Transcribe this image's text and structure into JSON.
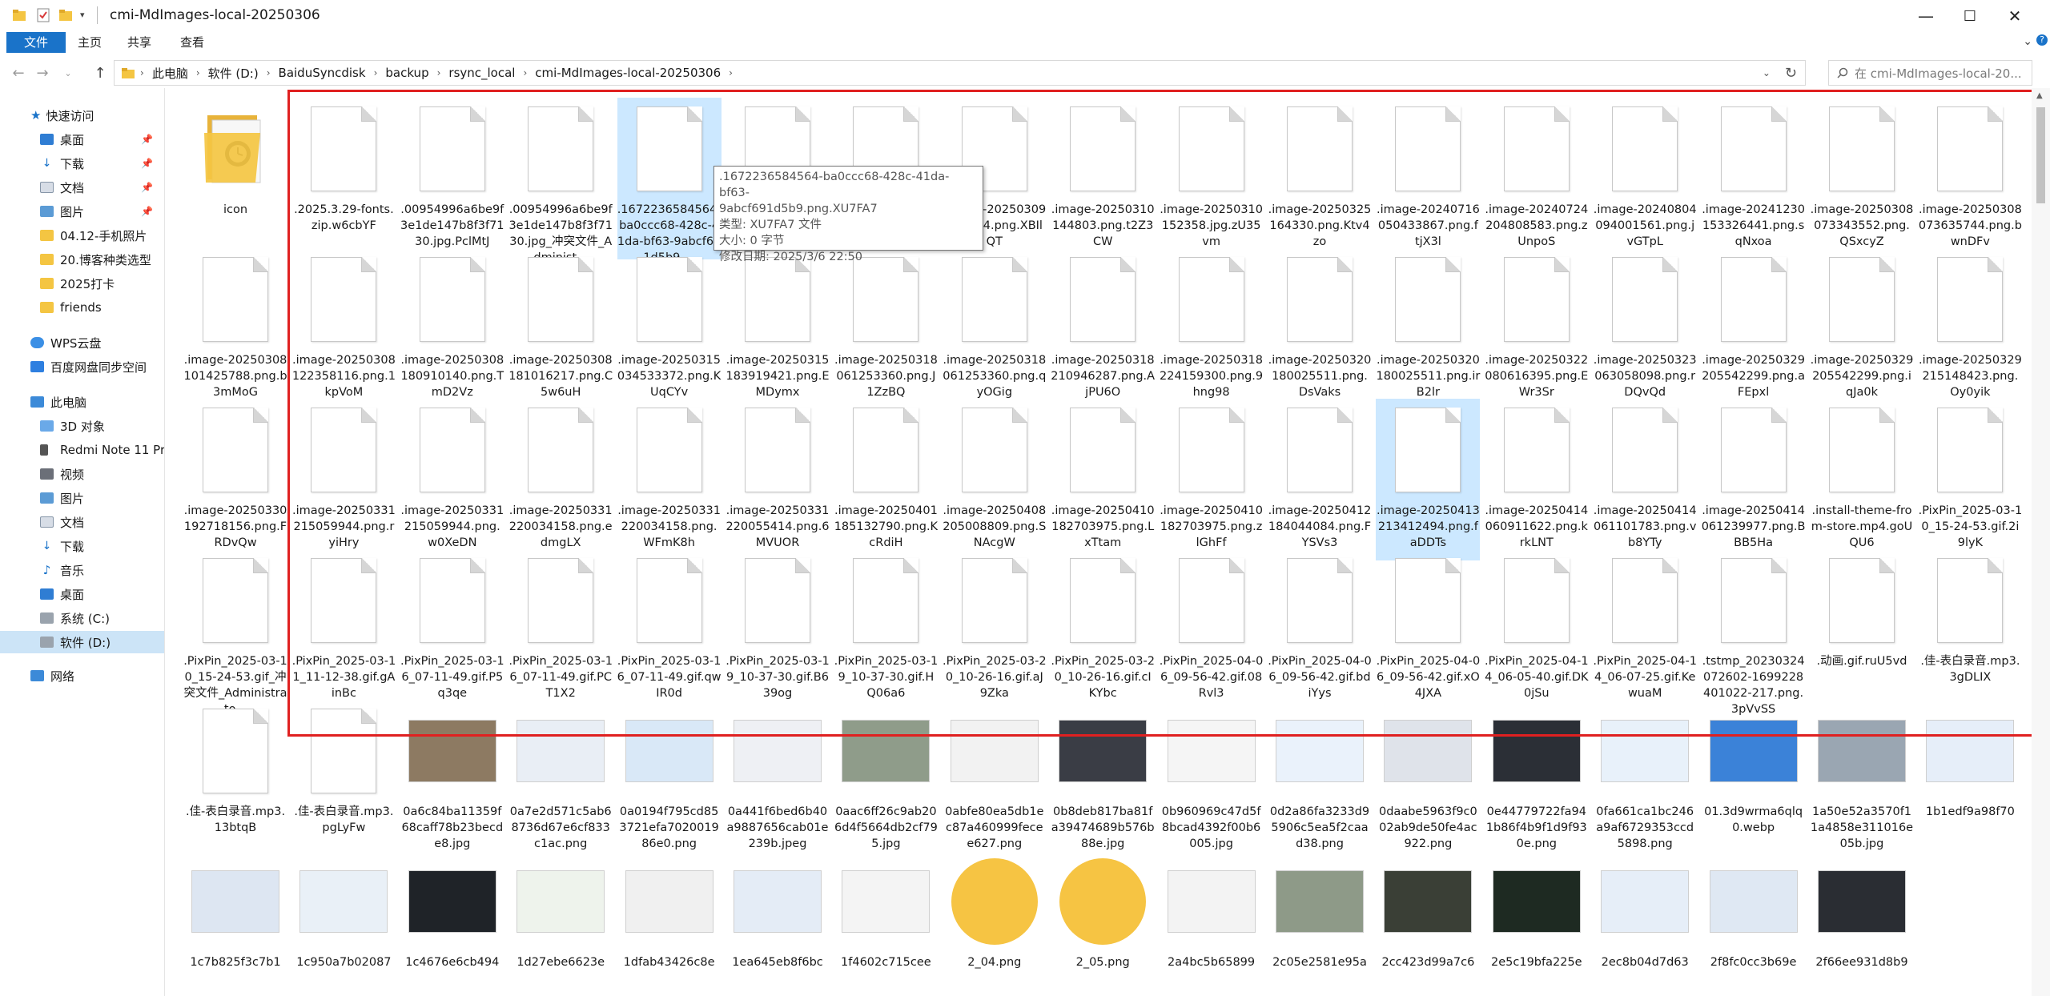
{
  "window": {
    "title": "cmi-MdImages-local-20250306",
    "controls": {
      "minimize": "—",
      "maximize": "☐",
      "close": "✕"
    }
  },
  "ribbon": {
    "tabs": [
      {
        "label": "文件",
        "active": true
      },
      {
        "label": "主页",
        "active": false
      },
      {
        "label": "共享",
        "active": false
      },
      {
        "label": "查看",
        "active": false
      }
    ]
  },
  "address": {
    "crumbs": [
      "此电脑",
      "软件 (D:)",
      "BaiduSyncdisk",
      "backup",
      "rsync_local",
      "cmi-MdImages-local-20250306"
    ],
    "search_placeholder": "在 cmi-MdImages-local-20..."
  },
  "navpane": {
    "quick_access": "快速访问",
    "quick_items": [
      {
        "label": "桌面",
        "pinned": true,
        "icon": "desktop-icon"
      },
      {
        "label": "下载",
        "pinned": true,
        "icon": "download-icon"
      },
      {
        "label": "文档",
        "pinned": true,
        "icon": "documents-icon"
      },
      {
        "label": "图片",
        "pinned": true,
        "icon": "pictures-icon"
      },
      {
        "label": "04.12-手机照片",
        "pinned": false,
        "icon": "folder-icon"
      },
      {
        "label": "20.博客种类选型",
        "pinned": false,
        "icon": "folder-icon"
      },
      {
        "label": "2025打卡",
        "pinned": false,
        "icon": "folder-icon"
      },
      {
        "label": "friends",
        "pinned": false,
        "icon": "folder-icon"
      }
    ],
    "wps": "WPS云盘",
    "baidu": "百度网盘同步空间",
    "this_pc": "此电脑",
    "pc_items": [
      {
        "label": "3D 对象",
        "icon": "3d-objects-icon"
      },
      {
        "label": "Redmi Note 11 Pr",
        "icon": "phone-icon"
      },
      {
        "label": "视频",
        "icon": "videos-icon"
      },
      {
        "label": "图片",
        "icon": "pictures-icon"
      },
      {
        "label": "文档",
        "icon": "documents-icon"
      },
      {
        "label": "下载",
        "icon": "download-icon"
      },
      {
        "label": "音乐",
        "icon": "music-icon"
      },
      {
        "label": "桌面",
        "icon": "desktop-icon"
      },
      {
        "label": "系统 (C:)",
        "icon": "drive-icon"
      },
      {
        "label": "软件 (D:)",
        "icon": "drive-icon",
        "selected": true
      }
    ],
    "network": "网络"
  },
  "tooltip": {
    "lines": [
      ".1672236584564-ba0ccc68-428c-41da-bf63-",
      "9abcf691d5b9.png.XU7FA7",
      "类型: XU7FA7 文件",
      "大小: 0 字节",
      "修改日期: 2025/3/6 22:50"
    ]
  },
  "files": [
    {
      "name": "icon",
      "kind": "folder"
    },
    {
      "name": ".2025.3.29-fonts.zip.w6cbYF",
      "kind": "doc"
    },
    {
      "name": ".00954996a6be9f3e1de147b8f3f7130.jpg.PclMtJ",
      "kind": "doc"
    },
    {
      "name": ".00954996a6be9f3e1de147b8f3f7130.jpg_冲突文件_Administ...",
      "kind": "doc"
    },
    {
      "name": ".1672236584564-ba0ccc68-428c-41da-bf63-9abcf691d5b9....",
      "kind": "doc",
      "selected": true
    },
    {
      "name": "rica",
      "kind": "doc"
    },
    {
      "name": ".image-202503…914.png.rpJza",
      "kind": "doc"
    },
    {
      "name": ".image-20250309171914.png.XBIlQT",
      "kind": "doc"
    },
    {
      "name": ".image-20250310144803.png.t2Z3CW",
      "kind": "doc"
    },
    {
      "name": ".image-20250310152358.jpg.zU35vm",
      "kind": "doc"
    },
    {
      "name": ".image-20250325164330.png.Ktv4zo",
      "kind": "doc"
    },
    {
      "name": ".image-20240716050433867.png.ftjX3l",
      "kind": "doc"
    },
    {
      "name": ".image-20240724204808583.png.zUnpoS",
      "kind": "doc"
    },
    {
      "name": ".image-20240804094001561.png.jvGTpL",
      "kind": "doc"
    },
    {
      "name": ".image-20241230153326441.png.sqNxoa",
      "kind": "doc"
    },
    {
      "name": ".image-20250308073343552.png.QSxcyZ",
      "kind": "doc"
    },
    {
      "name": ".image-20250308073635744.png.bwnDFv",
      "kind": "doc"
    },
    {
      "name": ".image-20250308101425788.png.b3mMoG",
      "kind": "doc"
    },
    {
      "name": ".image-20250308122358116.png.1kpVoM",
      "kind": "doc"
    },
    {
      "name": ".image-20250308180910140.png.TmD2Vz",
      "kind": "doc"
    },
    {
      "name": ".image-20250308181016217.png.C5w6uH",
      "kind": "doc"
    },
    {
      "name": ".image-20250315034533372.png.KUqCYv",
      "kind": "doc"
    },
    {
      "name": ".image-20250315183919421.png.EMDymx",
      "kind": "doc"
    },
    {
      "name": ".image-20250318061253360.png.J1ZzBQ",
      "kind": "doc"
    },
    {
      "name": ".image-20250318061253360.png.qyOGig",
      "kind": "doc"
    },
    {
      "name": ".image-20250318210946287.png.AjPU6O",
      "kind": "doc"
    },
    {
      "name": ".image-20250318224159300.png.9hng98",
      "kind": "doc"
    },
    {
      "name": ".image-20250320180025511.png.DsVaks",
      "kind": "doc"
    },
    {
      "name": ".image-20250320180025511.png.irB2lr",
      "kind": "doc"
    },
    {
      "name": ".image-20250322080616395.png.EWr3Sr",
      "kind": "doc"
    },
    {
      "name": ".image-20250323063058098.png.rDQvQd",
      "kind": "doc"
    },
    {
      "name": ".image-20250329205542299.png.aFEpxl",
      "kind": "doc"
    },
    {
      "name": ".image-20250329205542299.png.iqJa0k",
      "kind": "doc"
    },
    {
      "name": ".image-20250329215148423.png.Oy0yik",
      "kind": "doc"
    },
    {
      "name": ".image-20250330192718156.png.FRDvQw",
      "kind": "doc"
    },
    {
      "name": ".image-20250331215059944.png.ryiHry",
      "kind": "doc"
    },
    {
      "name": ".image-20250331215059944.png.w0XeDN",
      "kind": "doc"
    },
    {
      "name": ".image-20250331220034158.png.edmgLX",
      "kind": "doc"
    },
    {
      "name": ".image-20250331220034158.png.WFmK8h",
      "kind": "doc"
    },
    {
      "name": ".image-20250331220055414.png.6MVUOR",
      "kind": "doc"
    },
    {
      "name": ".image-20250401185132790.png.KcRdiH",
      "kind": "doc"
    },
    {
      "name": ".image-20250408205008809.png.SNAcgW",
      "kind": "doc"
    },
    {
      "name": ".image-20250410182703975.png.LxTtam",
      "kind": "doc"
    },
    {
      "name": ".image-20250410182703975.png.zlGhFf",
      "kind": "doc"
    },
    {
      "name": ".image-20250412184044084.png.FYSVs3",
      "kind": "doc"
    },
    {
      "name": ".image-20250413213412494.png.faDDTs",
      "kind": "doc",
      "selected": true
    },
    {
      "name": ".image-20250414060911622.png.krkLNT",
      "kind": "doc"
    },
    {
      "name": ".image-20250414061101783.png.vb8YTy",
      "kind": "doc"
    },
    {
      "name": ".image-20250414061239977.png.BBB5Ha",
      "kind": "doc"
    },
    {
      "name": ".install-theme-from-store.mp4.goUQU6",
      "kind": "doc"
    },
    {
      "name": ".PixPin_2025-03-10_15-24-53.gif.2i9lyK",
      "kind": "doc"
    },
    {
      "name": ".PixPin_2025-03-10_15-24-53.gif_冲突文件_Administrato...",
      "kind": "doc"
    },
    {
      "name": ".PixPin_2025-03-11_11-12-38.gif.gAinBc",
      "kind": "doc"
    },
    {
      "name": ".PixPin_2025-03-16_07-11-49.gif.P5q3qe",
      "kind": "doc"
    },
    {
      "name": ".PixPin_2025-03-16_07-11-49.gif.PCT1X2",
      "kind": "doc"
    },
    {
      "name": ".PixPin_2025-03-16_07-11-49.gif.qwIR0d",
      "kind": "doc"
    },
    {
      "name": ".PixPin_2025-03-19_10-37-30.gif.B639og",
      "kind": "doc"
    },
    {
      "name": ".PixPin_2025-03-19_10-37-30.gif.HQ06a6",
      "kind": "doc"
    },
    {
      "name": ".PixPin_2025-03-20_10-26-16.gif.aJ9Zka",
      "kind": "doc"
    },
    {
      "name": ".PixPin_2025-03-20_10-26-16.gif.cIKYbc",
      "kind": "doc"
    },
    {
      "name": ".PixPin_2025-04-06_09-56-42.gif.08Rvl3",
      "kind": "doc"
    },
    {
      "name": ".PixPin_2025-04-06_09-56-42.gif.bdiYys",
      "kind": "doc"
    },
    {
      "name": ".PixPin_2025-04-06_09-56-42.gif.xO4JXA",
      "kind": "doc"
    },
    {
      "name": ".PixPin_2025-04-14_06-05-40.gif.DK0jSu",
      "kind": "doc"
    },
    {
      "name": ".PixPin_2025-04-14_06-07-25.gif.KewuaM",
      "kind": "doc"
    },
    {
      "name": ".tstmp_20230324072602-1699228401022-217.png.3pVvSS",
      "kind": "doc"
    },
    {
      "name": ".动画.gif.ruU5vd",
      "kind": "doc"
    },
    {
      "name": ".佳-表白录音.mp3.3gDLIX",
      "kind": "doc"
    },
    {
      "name": ".佳-表白录音.mp3.13btqB",
      "kind": "doc"
    },
    {
      "name": ".佳-表白录音.mp3.pgLyFw",
      "kind": "doc"
    },
    {
      "name": "0a6c84ba11359f68caff78b23becde8.jpg",
      "kind": "img",
      "color": "#8d7a62"
    },
    {
      "name": "0a7e2d571c5ab68736d67e6cf833c1ac.png",
      "kind": "img",
      "color": "#e9eef5"
    },
    {
      "name": "0a0194f795cd853721efa702001986e0.png",
      "kind": "img",
      "color": "#d9e8f7"
    },
    {
      "name": "0a441f6bed6b40a9887656cab01e239b.jpeg",
      "kind": "img",
      "color": "#eef0f4"
    },
    {
      "name": "0aac6ff26c9ab206d4f5664db2cf795.jpg",
      "kind": "img",
      "color": "#8f9c8a"
    },
    {
      "name": "0abfe80ea5db1ec87a460999fecee627.png",
      "kind": "img",
      "color": "#f2f2f2"
    },
    {
      "name": "0b8deb817ba81fa39474689b576b88e.jpg",
      "kind": "img",
      "color": "#3a3d45"
    },
    {
      "name": "0b960969c47d5f8bcad4392f00b6005.jpg",
      "kind": "img",
      "color": "#f5f5f5"
    },
    {
      "name": "0d2a86fa3233d95906c5ea5f2caad38.png",
      "kind": "img",
      "color": "#eaf2fb"
    },
    {
      "name": "0daabe5963f9c002ab9de50fe4ac922.png",
      "kind": "img",
      "color": "#dfe3ea"
    },
    {
      "name": "0e44779722fa941b86f4b9f1d9f930e.png",
      "kind": "img",
      "color": "#2b2f36"
    },
    {
      "name": "0fa661ca1bc246a9af6729353ccd5898.png",
      "kind": "img",
      "color": "#e8f1fa"
    },
    {
      "name": "01.3d9wrma6qlq0.webp",
      "kind": "img",
      "color": "#3b82d8"
    },
    {
      "name": "1a50e52a3570f11a4858e311016e05b.jpg",
      "kind": "img",
      "color": "#9aa6b2"
    },
    {
      "name": "1b1edf9a98f70",
      "kind": "img",
      "color": "#e6eef9"
    },
    {
      "name": "1c7b825f3c7b1",
      "kind": "img",
      "color": "#dde6f2"
    },
    {
      "name": "1c950a7b02087",
      "kind": "img",
      "color": "#e9f0f7"
    },
    {
      "name": "1c4676e6cb494",
      "kind": "img",
      "color": "#1f2328"
    },
    {
      "name": "1d27ebe6623e",
      "kind": "img",
      "color": "#eef3ec"
    },
    {
      "name": "1dfab43426c8e",
      "kind": "img",
      "color": "#f0f0f0"
    },
    {
      "name": "1ea645eb8f6bc",
      "kind": "img",
      "color": "#e4ecf6"
    },
    {
      "name": "1f4602c715cee",
      "kind": "img",
      "color": "#f4f4f4"
    },
    {
      "name": "2_04.png",
      "kind": "img",
      "color": "#f6c443"
    },
    {
      "name": "2_05.png",
      "kind": "img",
      "color": "#f6c443"
    },
    {
      "name": "2a4bc5b65899",
      "kind": "img",
      "color": "#f3f3f3"
    },
    {
      "name": "2c05e2581e95a",
      "kind": "img",
      "color": "#8e9a88"
    },
    {
      "name": "2cc423d99a7c6",
      "kind": "img",
      "color": "#3a3f36"
    },
    {
      "name": "2e5c19bfa225e",
      "kind": "img",
      "color": "#1e2a22"
    },
    {
      "name": "2ec8b04d7d63",
      "kind": "img",
      "color": "#e6eef8"
    },
    {
      "name": "2f8fc0cc3b69e",
      "kind": "img",
      "color": "#dfe8f3"
    },
    {
      "name": "2f66ee931d8b9",
      "kind": "img",
      "color": "#2a2d33"
    }
  ]
}
